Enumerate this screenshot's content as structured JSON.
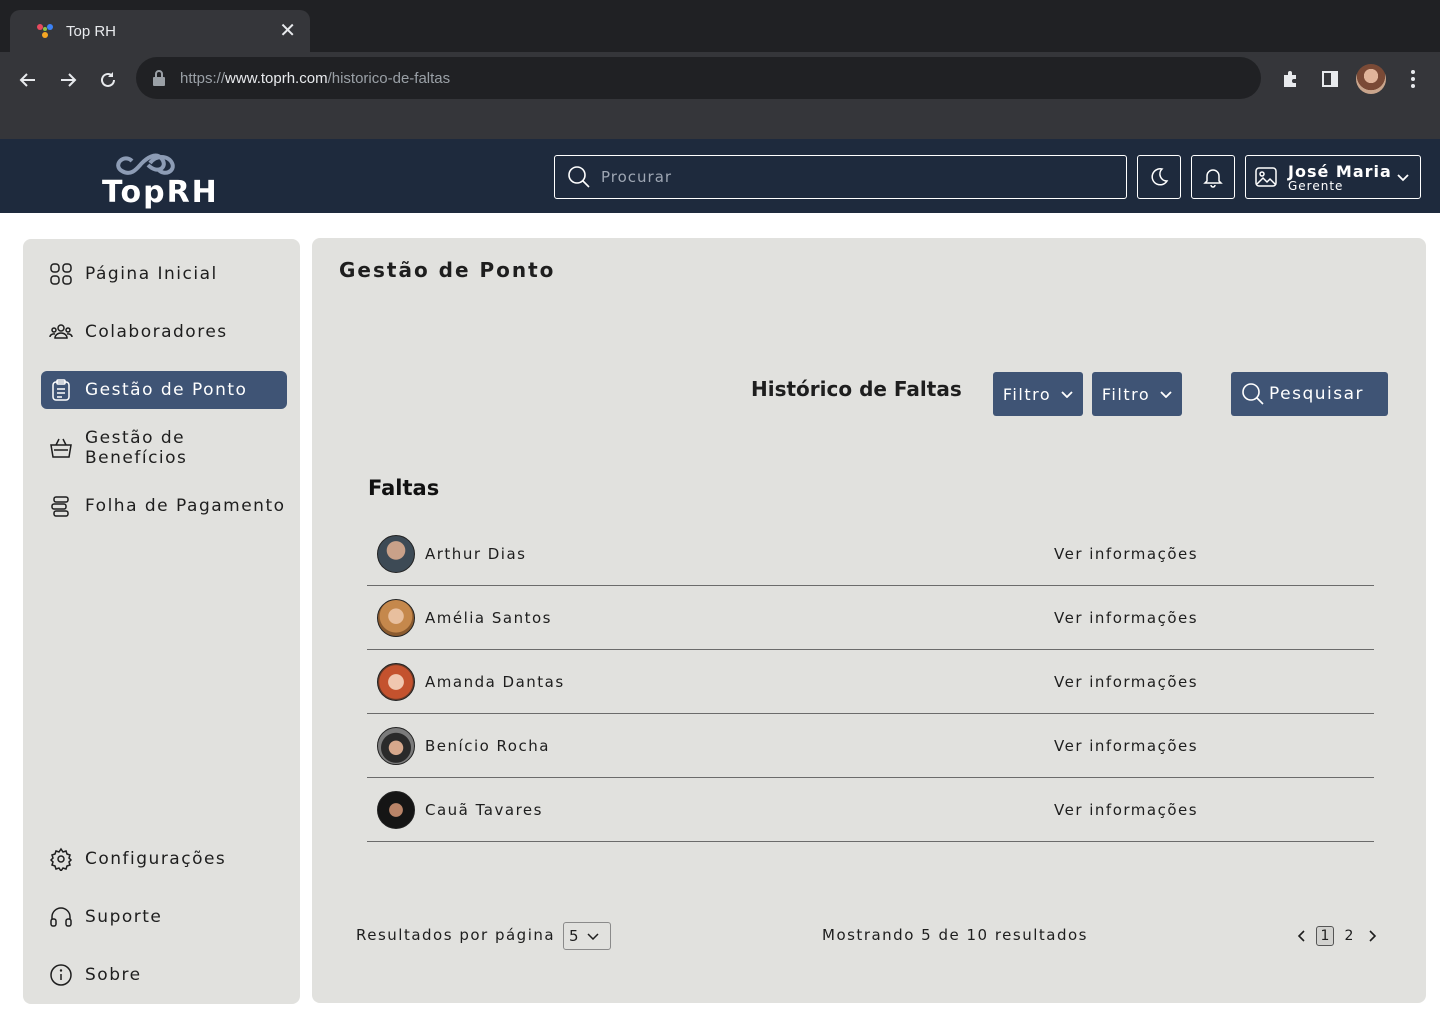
{
  "browser": {
    "tab_title": "Top RH",
    "url_proto": "https://",
    "url_host": "www.toprh.com",
    "url_path": "/historico-de-faltas"
  },
  "header": {
    "logo_text": "TopRH",
    "search_placeholder": "Procurar",
    "user_name": "José Maria",
    "user_role": "Gerente"
  },
  "sidebar": {
    "items": [
      {
        "label": "Página Inicial",
        "icon": "grid-icon"
      },
      {
        "label": "Colaboradores",
        "icon": "users-icon"
      },
      {
        "label": "Gestão de Ponto",
        "icon": "clipboard-icon",
        "active": true
      },
      {
        "label": "Gestão de Benefícios",
        "icon": "basket-icon"
      },
      {
        "label": "Folha de Pagamento",
        "icon": "money-icon"
      }
    ],
    "bottom_items": [
      {
        "label": "Configurações",
        "icon": "gear-icon"
      },
      {
        "label": "Suporte",
        "icon": "headset-icon"
      },
      {
        "label": "Sobre",
        "icon": "info-icon"
      }
    ]
  },
  "main": {
    "page_title": "Gestão de Ponto",
    "section_title": "Histórico de Faltas",
    "filters": [
      "Filtro",
      "Filtro"
    ],
    "search_button": "Pesquisar",
    "list_title": "Faltas",
    "rows": [
      {
        "name": "Arthur Dias",
        "link": "Ver informações"
      },
      {
        "name": "Amélia Santos",
        "link": "Ver informações"
      },
      {
        "name": "Amanda Dantas",
        "link": "Ver informações"
      },
      {
        "name": "Benício Rocha",
        "link": "Ver informações"
      },
      {
        "name": "Cauã Tavares",
        "link": "Ver informações"
      }
    ],
    "results_per_page_label": "Resultados por página",
    "results_per_page_value": "5",
    "showing_text": "Mostrando 5 de 10 resultados",
    "pages": [
      "1",
      "2"
    ],
    "current_page": "1"
  },
  "colors": {
    "header_bg": "#1e2a3d",
    "accent": "#3f5475",
    "panel_bg": "#e1e1de"
  }
}
